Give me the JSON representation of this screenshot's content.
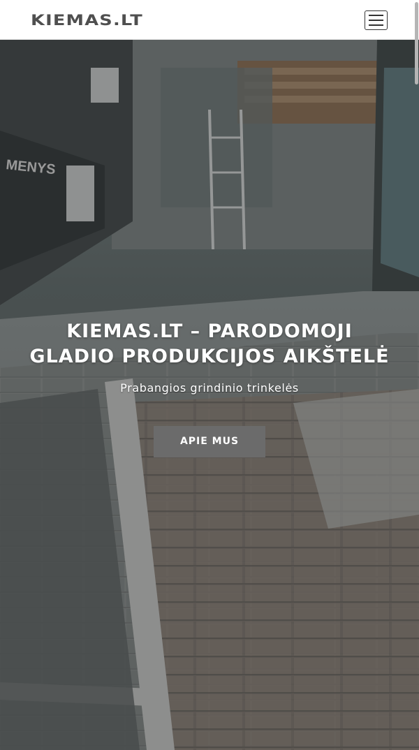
{
  "header": {
    "logo_text": "KIEMAS.LT",
    "menu_icon": "hamburger-menu-icon"
  },
  "hero": {
    "title": "KIEMAS.LT – PARODOMOJI GLADIO PRODUKCIJOS AIKŠTELĖ",
    "subtitle": "Prabangios grindinio trinkelės",
    "button_label": "APIE MUS",
    "background_image": "paving-showroom-photo"
  },
  "colors": {
    "logo": "#4f4f4f",
    "button_bg": "#6b6b6b",
    "hero_text": "#ffffff"
  }
}
